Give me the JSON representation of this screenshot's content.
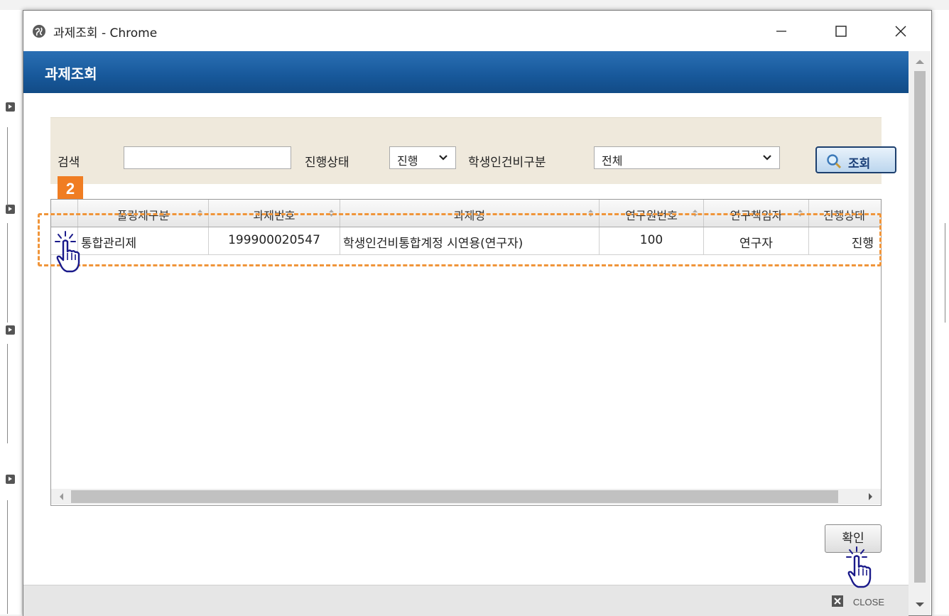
{
  "window": {
    "title": "과제조회 - Chrome",
    "controls": [
      "minimize",
      "maximize",
      "close"
    ]
  },
  "header": {
    "title": "과제조회"
  },
  "filter": {
    "search_label": "검색",
    "search_value": "",
    "status_label": "진행상태",
    "status_value": "진행",
    "category_label": "학생인건비구분",
    "category_value": "전체",
    "search_button": "조회"
  },
  "step_badge": "2",
  "table": {
    "columns": [
      "풀링제구분",
      "과제번호",
      "과제명",
      "연구원번호",
      "연구책임자",
      "진행상태"
    ],
    "rows": [
      [
        "통합관리제",
        "199900020547",
        "학생인건비통합계정 시연용(연구자)",
        "100",
        "연구자",
        "진행"
      ]
    ]
  },
  "confirm_button": "확인",
  "footer": {
    "close_label": "CLOSE"
  },
  "colors": {
    "header_blue": "#17589a",
    "highlight_orange": "#f0953a",
    "badge_orange": "#f07d22"
  }
}
